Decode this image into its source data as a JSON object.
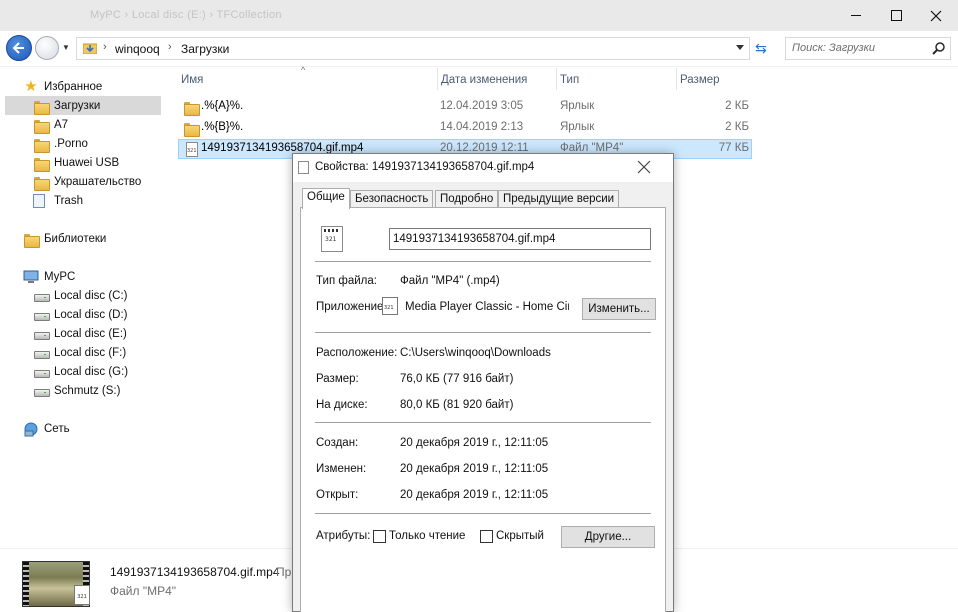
{
  "window": {
    "ghost_title": "MyPC › Local disc (E:) › TFCollection"
  },
  "address": {
    "crumbs": [
      "winqooq",
      "Загрузки"
    ],
    "search_placeholder": "Поиск: Загрузки"
  },
  "sidebar": {
    "favorites_label": "Избранное",
    "favorites": [
      "Загрузки",
      "A7",
      ".Porno",
      "Huawei USB",
      "Украшательство",
      "Trash"
    ],
    "libraries_label": "Библиотеки",
    "computer_label": "MyPC",
    "drives": [
      "Local disc (C:)",
      "Local disc (D:)",
      "Local disc (E:)",
      "Local disc (F:)",
      "Local disc (G:)",
      "Schmutz (S:)"
    ],
    "network_label": "Сеть"
  },
  "filelist": {
    "columns": [
      "Имя",
      "Дата изменения",
      "Тип",
      "Размер"
    ],
    "rows": [
      {
        "name": ".%{A}%.",
        "date": "12.04.2019 3:05",
        "type": "Ярлык",
        "size": "2 КБ"
      },
      {
        "name": ".%{B}%.",
        "date": "14.04.2019 2:13",
        "type": "Ярлык",
        "size": "2 КБ"
      },
      {
        "name": "1491937134193658704.gif.mp4",
        "date": "20.12.2019 12:11",
        "type": "Файл \"MP4\"",
        "size": "77 КБ"
      }
    ]
  },
  "details": {
    "name": "1491937134193658704.gif.mp4",
    "type": "Файл \"MP4\"",
    "extra": "Пр"
  },
  "dialog": {
    "title": "Свойства: 1491937134193658704.gif.mp4",
    "tabs": [
      "Общие",
      "Безопасность",
      "Подробно",
      "Предыдущие версии"
    ],
    "file_name": "1491937134193658704.gif.mp4",
    "file_type_label": "Тип файла:",
    "file_type": "Файл \"MP4\" (.mp4)",
    "app_label": "Приложение:",
    "app_name": "Media Player Classic - Home Cinema",
    "change_button": "Изменить...",
    "location_label": "Расположение:",
    "location": "C:\\Users\\winqooq\\Downloads",
    "size_label": "Размер:",
    "size": "76,0 КБ (77 916 байт)",
    "disk_label": "На диске:",
    "disk": "80,0 КБ (81 920 байт)",
    "created_label": "Создан:",
    "created": "20 декабря 2019 г., 12:11:05",
    "modified_label": "Изменен:",
    "modified": "20 декабря 2019 г., 12:11:05",
    "opened_label": "Открыт:",
    "opened": "20 декабря 2019 г., 12:11:05",
    "attributes_label": "Атрибуты:",
    "readonly_label": "Только чтение",
    "hidden_label": "Скрытый",
    "other_button": "Другие..."
  }
}
